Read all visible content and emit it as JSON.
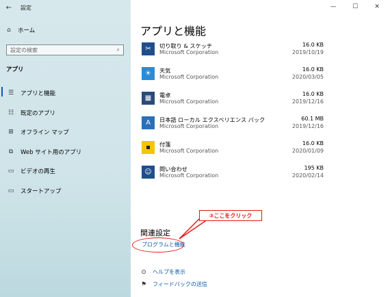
{
  "window": {
    "back_icon": "←",
    "title": "設定",
    "controls": {
      "minimize": "—",
      "maximize": "☐",
      "close": "✕"
    }
  },
  "sidebar": {
    "home_icon": "⌂",
    "home_label": "ホーム",
    "search_placeholder": "設定の検索",
    "search_icon": "⌕",
    "section_label": "アプリ",
    "items": [
      {
        "icon": "☰",
        "label": "アプリと機能",
        "active": true
      },
      {
        "icon": "☷",
        "label": "既定のアプリ",
        "active": false
      },
      {
        "icon": "⊞",
        "label": "オフライン マップ",
        "active": false
      },
      {
        "icon": "⧉",
        "label": "Web サイト用のアプリ",
        "active": false
      },
      {
        "icon": "▭",
        "label": "ビデオの再生",
        "active": false
      },
      {
        "icon": "▭",
        "label": "スタートアップ",
        "active": false
      }
    ]
  },
  "main": {
    "page_title": "アプリと機能",
    "apps": [
      {
        "icon": "✂",
        "icon_color": "#1f4e8c",
        "name": "切り取り & スケッチ",
        "publisher": "Microsoft Corporation",
        "size": "16.0 KB",
        "date": "2019/10/19"
      },
      {
        "icon": "☀",
        "icon_color": "#2b8bd6",
        "name": "天気",
        "publisher": "Microsoft Corporation",
        "size": "16.0 KB",
        "date": "2020/03/05"
      },
      {
        "icon": "▦",
        "icon_color": "#2a4a7a",
        "name": "電卓",
        "publisher": "Microsoft Corporation",
        "size": "16.0 KB",
        "date": "2019/12/16"
      },
      {
        "icon": "A",
        "icon_color": "#2b6fb8",
        "name": "日本語 ローカル エクスペリエンス パック",
        "publisher": "Microsoft Corporation",
        "size": "60.1 MB",
        "date": "2019/12/16"
      },
      {
        "icon": "▪",
        "icon_color": "#f4c600",
        "name": "付箋",
        "publisher": "Microsoft Corporation",
        "size": "16.0 KB",
        "date": "2020/01/09"
      },
      {
        "icon": "☺",
        "icon_color": "#1f4e8c",
        "name": "問い合わせ",
        "publisher": "Microsoft Corporation",
        "size": "195 KB",
        "date": "2020/02/14"
      }
    ],
    "related_heading": "関連設定",
    "related_link": "プログラムと機能",
    "help_icon": "⊙",
    "help_label": "ヘルプを表示",
    "feedback_icon": "⚑",
    "feedback_label": "フィードバックの送信"
  },
  "annotation": {
    "callout_text": "③ここをクリック",
    "color": "#e61616"
  }
}
